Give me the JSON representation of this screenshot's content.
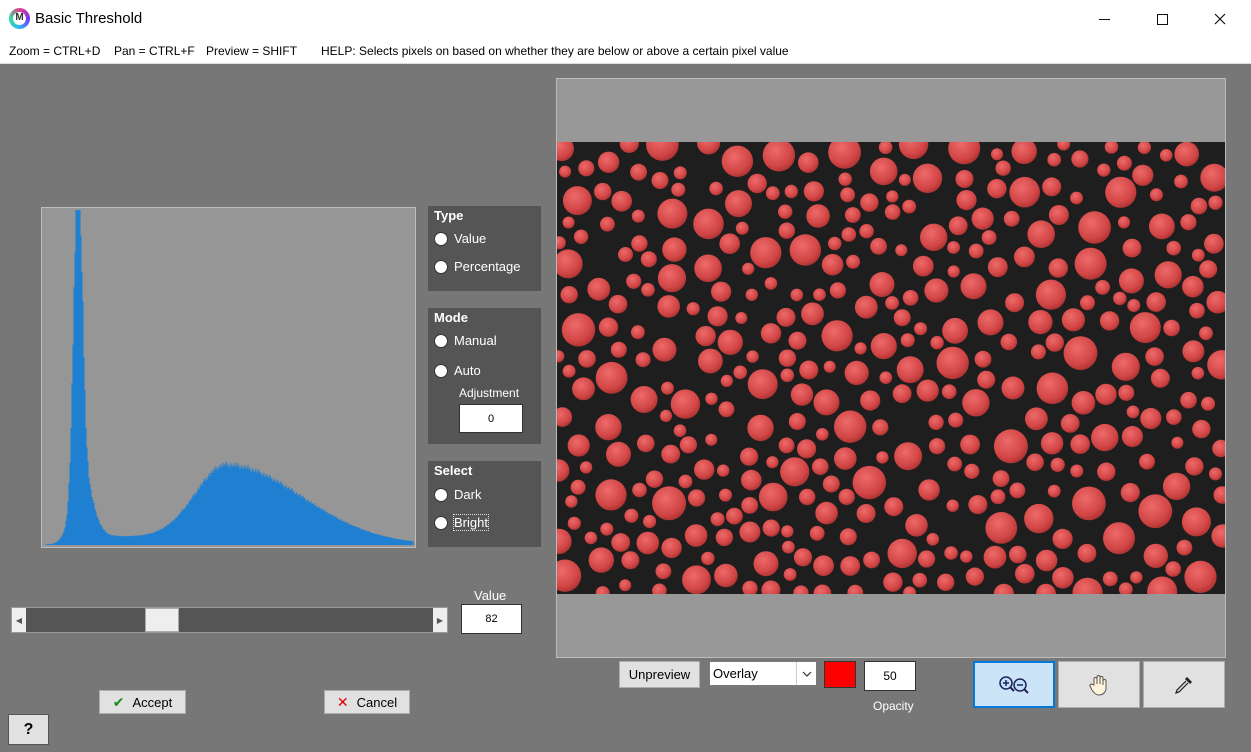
{
  "window": {
    "title": "Basic Threshold",
    "logo_letter": "M"
  },
  "hints": {
    "zoom": "Zoom = CTRL+D",
    "pan": "Pan = CTRL+F",
    "preview": "Preview = SHIFT",
    "help": "HELP:  Selects pixels on based on whether they are below or above a certain pixel value"
  },
  "type_group": {
    "title": "Type",
    "options": [
      "Value",
      "Percentage"
    ]
  },
  "mode_group": {
    "title": "Mode",
    "options": [
      "Manual",
      "Auto"
    ],
    "adjustment_label": "Adjustment",
    "adjustment_value": "0"
  },
  "select_group": {
    "title": "Select",
    "options": [
      "Dark",
      "Bright"
    ]
  },
  "threshold": {
    "value_label": "Value",
    "value": "82",
    "slider_fraction": 0.32
  },
  "buttons": {
    "accept": "Accept",
    "cancel": "Cancel",
    "help": "?",
    "unpreview": "Unpreview"
  },
  "overlay": {
    "selected": "Overlay",
    "color": "#ff0000",
    "opacity": "50",
    "opacity_label": "Opacity"
  },
  "tools": [
    "zoom-icon",
    "hand-icon",
    "eyedropper-icon"
  ],
  "histogram_color": "#1f7fd0"
}
